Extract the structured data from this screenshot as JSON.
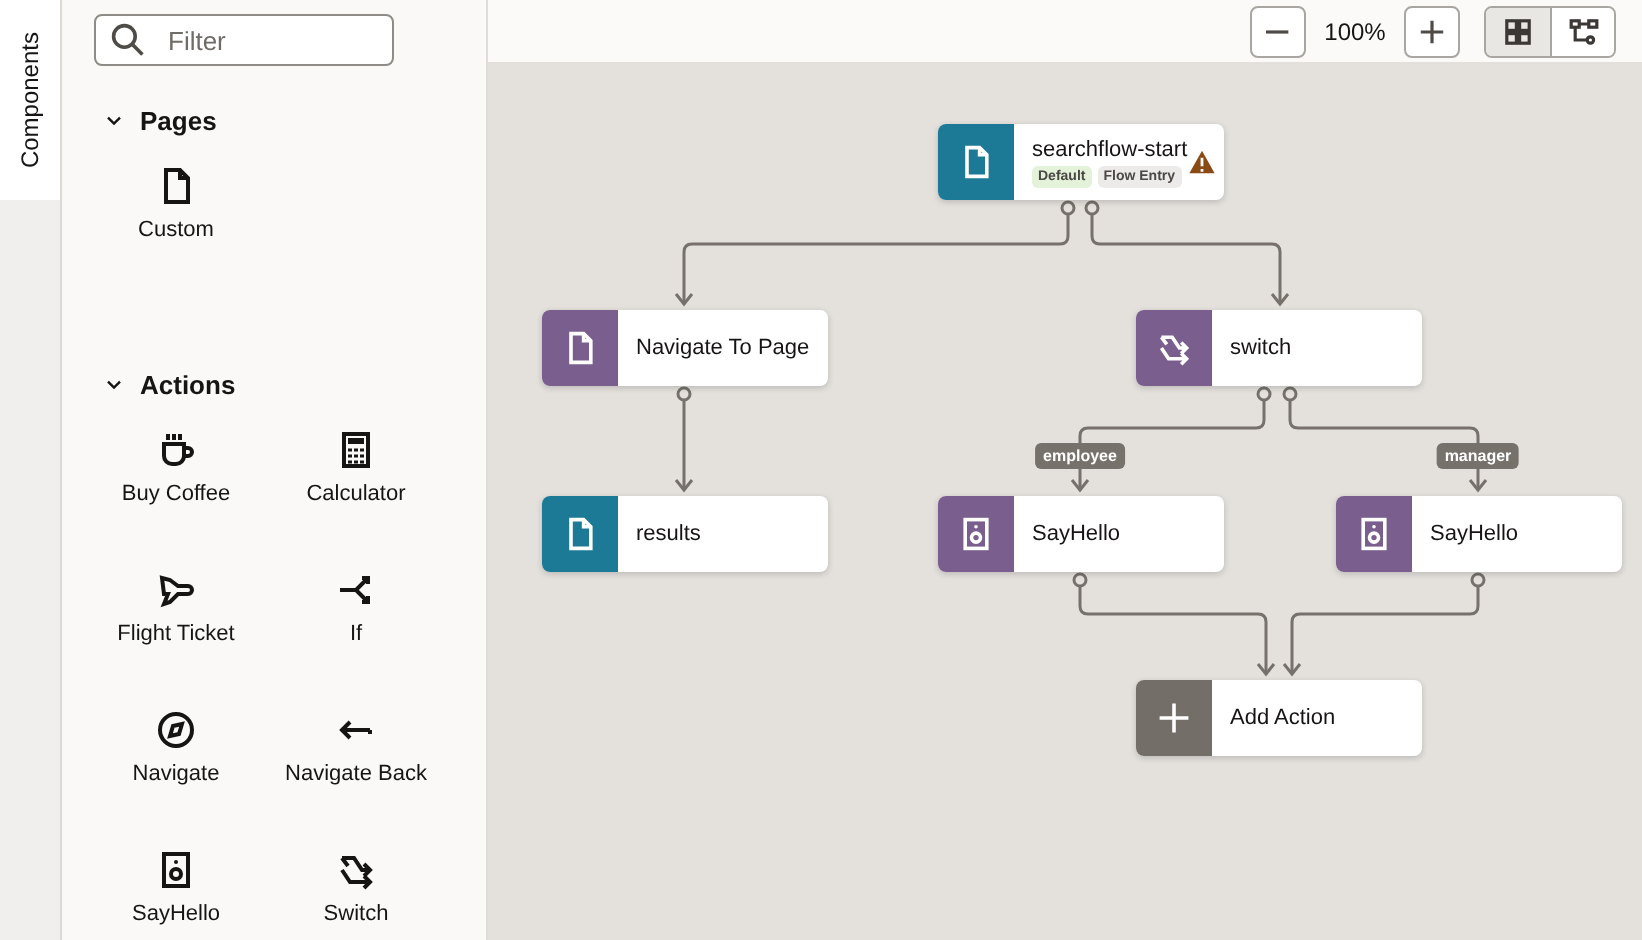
{
  "rail": {
    "tab": {
      "label": "Components",
      "selected": true
    }
  },
  "sidebar": {
    "filter": {
      "placeholder": "Filter"
    },
    "sections": [
      {
        "title": "Pages",
        "expanded": true,
        "items": [
          {
            "label": "Custom",
            "kind": "document"
          }
        ]
      },
      {
        "title": "Actions",
        "expanded": true,
        "items": [
          {
            "label": "Buy Coffee",
            "kind": "coffee"
          },
          {
            "label": "Calculator",
            "kind": "calculator"
          },
          {
            "label": "Flight Ticket",
            "kind": "plane"
          },
          {
            "label": "If",
            "kind": "branch"
          },
          {
            "label": "Navigate",
            "kind": "compass"
          },
          {
            "label": "Navigate Back",
            "kind": "back"
          },
          {
            "label": "SayHello",
            "kind": "speaker"
          },
          {
            "label": "Switch",
            "kind": "switch"
          }
        ]
      }
    ]
  },
  "toolbar": {
    "zoom": "100%",
    "views": [
      {
        "kind": "grid",
        "selected": true
      },
      {
        "kind": "flow",
        "selected": false
      }
    ]
  },
  "canvas": {
    "nodes": [
      {
        "label": "searchflow-start",
        "kind": "page",
        "warning": true,
        "badges": [
          {
            "label": "Default",
            "color": "#e3f2d9"
          },
          {
            "label": "Flow Entry",
            "color": "#ecebea"
          }
        ]
      },
      {
        "label": "Navigate To Page",
        "kind": "navigate",
        "warning": false
      },
      {
        "label": "switch",
        "kind": "switch",
        "warning": false
      },
      {
        "label": "results",
        "kind": "page",
        "warning": false
      },
      {
        "label": "SayHello",
        "kind": "speaker",
        "warning": false
      },
      {
        "label": "SayHello",
        "kind": "speaker",
        "warning": false
      },
      {
        "label": "Add Action",
        "kind": "add",
        "warning": false
      }
    ],
    "branches": [
      {
        "label": "employee"
      },
      {
        "label": "manager"
      }
    ]
  }
}
